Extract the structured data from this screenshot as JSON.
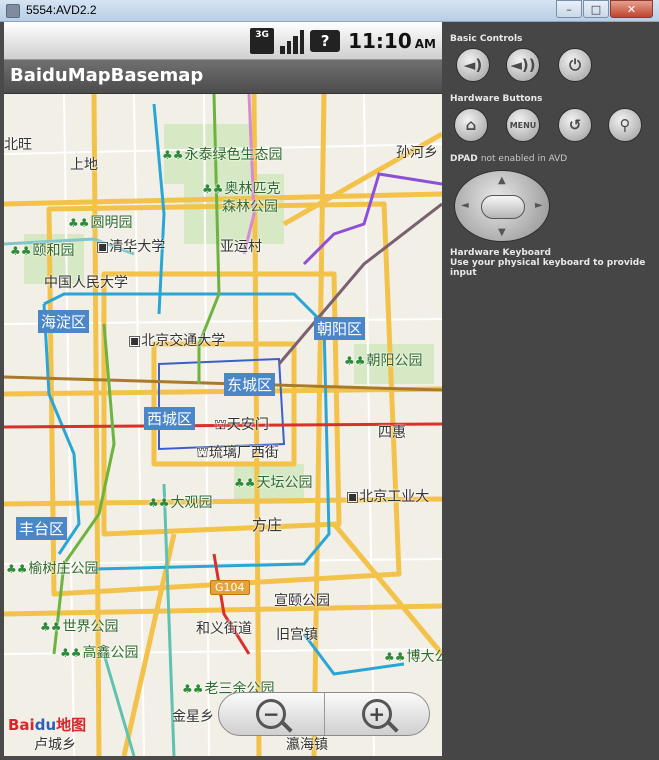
{
  "window": {
    "title": "5554:AVD2.2",
    "minimize_glyph": "–",
    "maximize_glyph": "□",
    "close_glyph": "✕"
  },
  "statusbar": {
    "network": "3G",
    "battery_glyph": "?",
    "time": "11:10",
    "ampm": "AM"
  },
  "app": {
    "title": "BaiduMapBasemap"
  },
  "map": {
    "labels": {
      "beiwang": "北旺",
      "shangdi": "上地",
      "yongtai": "永泰绿色生态园",
      "sunhe": "孙河乡",
      "olympic": "奥林匹克森林公园",
      "olympic_1": "奥林匹克",
      "olympic_2": "森林公园",
      "yuanmingyuan": "圆明园",
      "yiheyuan": "颐和园",
      "tsinghua": "清华大学",
      "yayuncun": "亚运村",
      "renmin": "中国人民大学",
      "haidian": "海淀区",
      "chaoyang": "朝阳区",
      "jiaotong": "北京交通大学",
      "chaoyang_park": "朝阳公园",
      "dongcheng": "东城区",
      "xicheng": "西城区",
      "tiananmen": "天安门",
      "sihui": "四惠",
      "liulichang": "琉璃厂西街",
      "tiantan": "天坛公园",
      "grandview": "大观园",
      "bjut": "北京工业大",
      "fangzhuang": "方庄",
      "fengtai": "丰台区",
      "yushu": "榆树庄公园",
      "g104": "G104",
      "xuanyi": "宣颐公园",
      "world_park": "世界公园",
      "heyi": "和义街道",
      "jiugong": "旧宫镇",
      "gaoxin": "高鑫公园",
      "bodaxing": "博大公",
      "laosanhe": "老三余公园",
      "jinxing": "金星乡",
      "lucheng": "卢城乡",
      "yingqiao": "瀛海镇"
    },
    "logo_text": "Bai",
    "logo_paw": "du",
    "logo_suffix": "地图",
    "colors": {
      "ring_road": "#f3c24a",
      "subway_blue": "#2aa6d6",
      "subway_green": "#6cb33f",
      "subway_red": "#d9302b",
      "subway_purple": "#8d4fd6",
      "subway_brown": "#a97a2c",
      "district_badge": "#4b86c8"
    }
  },
  "zoom": {
    "out_label": "−",
    "in_label": "+"
  },
  "panel": {
    "basic_controls": "Basic Controls",
    "hardware_buttons": "Hardware Buttons",
    "dpad": "DPAD",
    "dpad_status": "not enabled in AVD",
    "keyboard_title": "Hardware Keyboard",
    "keyboard_note": "Use your physical keyboard to provide input",
    "btn_volume_down": "◄)",
    "btn_volume_up": "◄))",
    "btn_power": "⏻",
    "btn_home": "⌂",
    "btn_menu": "MENU",
    "btn_back": "↺",
    "btn_search": "⚲"
  }
}
